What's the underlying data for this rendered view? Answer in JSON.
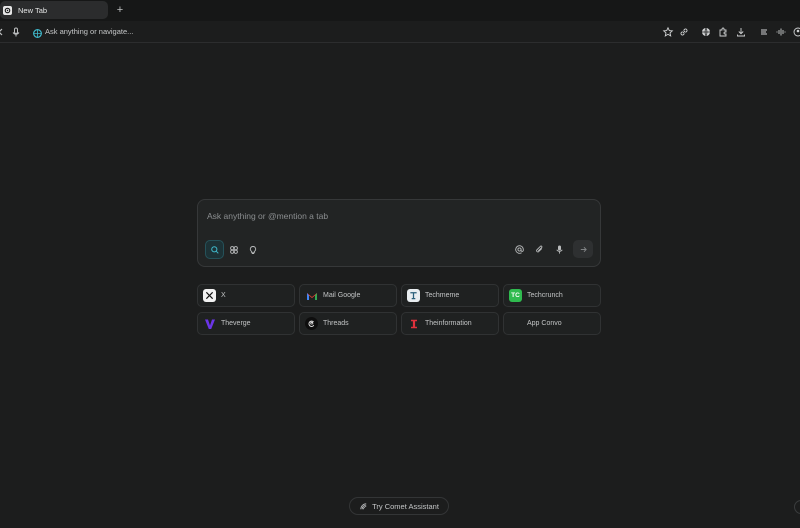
{
  "tab": {
    "title": "New Tab",
    "new_tab_symbol": "+"
  },
  "toolbar": {
    "omnibox_placeholder": "Ask anything or navigate...",
    "left_icons": [
      "back-icon",
      "microphone-icon"
    ],
    "right_icons": [
      "star-icon",
      "link-icon",
      "globe-icon",
      "extensions-icon",
      "download-icon",
      "menu-lines-icon",
      "audio-wave-icon",
      "profile-icon"
    ]
  },
  "composer": {
    "placeholder": "Ask anything or @mention a tab",
    "modes": [
      "search-icon",
      "research-icon",
      "lightbulb-icon"
    ],
    "right_icons": [
      "at-icon",
      "attach-icon",
      "microphone-icon",
      "send-arrow-icon"
    ]
  },
  "shortcuts": [
    {
      "label": "X",
      "logo": "x-logo"
    },
    {
      "label": "Mail Google",
      "logo": "gmail-logo"
    },
    {
      "label": "Techmeme",
      "logo": "techmeme-logo"
    },
    {
      "label": "Techcrunch",
      "logo": "techcrunch-logo",
      "logo_text": "TC"
    },
    {
      "label": "Theverge",
      "logo": "verge-logo"
    },
    {
      "label": "Threads",
      "logo": "threads-logo"
    },
    {
      "label": "Theinformation",
      "logo": "theinformation-logo"
    },
    {
      "label": "App Convo",
      "logo": "none"
    }
  ],
  "assistant": {
    "label": "Try Comet Assistant"
  },
  "colors": {
    "background": "#1c1d1d",
    "accent_teal": "#3fb7c9",
    "techcrunch_green": "#2fbb4f",
    "verge_purple": "#6b35e8",
    "theinformation_red": "#e0313c"
  }
}
